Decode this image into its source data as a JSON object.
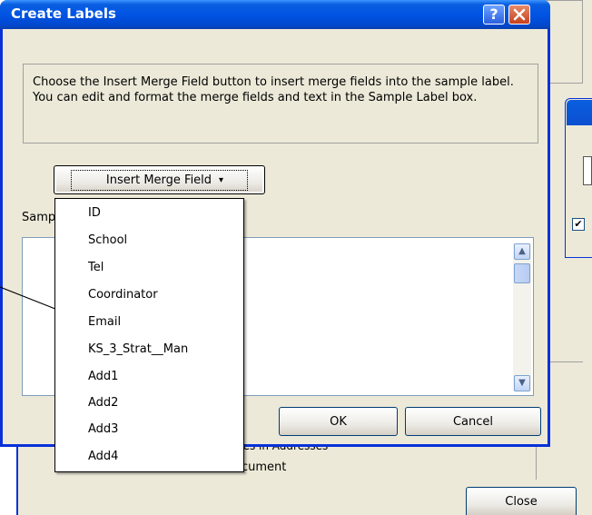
{
  "dialog": {
    "title": "Create Labels",
    "help_glyph": "?",
    "instructions": "Choose the Insert Merge Field button to insert merge fields into the sample label.  You can edit and format the merge fields and text in the Sample Label box.",
    "insert_button_label": "Insert Merge Field",
    "insert_button_caret": "▾",
    "sample_label_partial": "Samp",
    "ok_label": "OK",
    "cancel_label": "Cancel"
  },
  "merge_fields": [
    "ID",
    "School",
    "Tel",
    "Coordinator",
    "Email",
    "KS_3_Strat__Man",
    "Add1",
    "Add2",
    "Add3",
    "Add4"
  ],
  "background": {
    "partial_text_1": "nes in Addresses",
    "partial_text_2": "cument",
    "close_label": "Close",
    "checkbox_mark": "✔"
  },
  "colors": {
    "titlebar": "#0054e3",
    "dialog_face": "#ece9d8",
    "close_button": "#d8532a"
  },
  "scrollbar": {
    "up_glyph": "▲",
    "down_glyph": "▼"
  }
}
